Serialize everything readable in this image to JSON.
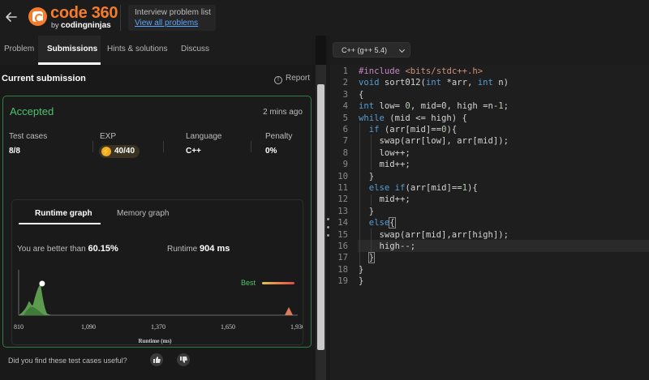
{
  "header": {
    "logo_name": "code 360",
    "logo_by": "by",
    "logo_brand": "codingninjas",
    "list_title": "Interview problem list",
    "list_link": "View all problems"
  },
  "tabs": [
    "Problem",
    "Submissions",
    "Hints & solutions",
    "Discuss"
  ],
  "submission": {
    "section_title": "Current submission",
    "report_label": "Report",
    "status": "Accepted",
    "time_ago": "2 mins ago",
    "stats": [
      {
        "label": "Test cases",
        "value": "8/8"
      },
      {
        "label": "EXP",
        "value": "40/40"
      },
      {
        "label": "Language",
        "value": "C++"
      },
      {
        "label": "Penalty",
        "value": "0%"
      }
    ],
    "graph_tabs": [
      "Runtime graph",
      "Memory graph"
    ],
    "better_prefix": "You are better than",
    "better_value": "60.15%",
    "runtime_prefix": "Runtime",
    "runtime_value": "904 ms",
    "best_label": "Best",
    "feedback_question": "Did you find these test cases useful?"
  },
  "chart_data": {
    "type": "area",
    "xlabel": "Runtime (ms)",
    "x_ticks": [
      "810",
      "1,090",
      "1,370",
      "1,650",
      "1,930"
    ],
    "xlim": [
      810,
      1930
    ],
    "marker_x": 904,
    "legend": "Best"
  },
  "editor": {
    "language": "C++ (g++ 5.4)",
    "lines": [
      "#include <bits/stdc++.h>",
      "void sort012(int *arr, int n)",
      "{",
      "int low= 0, mid=0, high =n-1;",
      "while (mid <= high) {",
      "  if (arr[mid]==0){",
      "    swap(arr[low], arr[mid]);",
      "    low++;",
      "    mid++;",
      "  }",
      "  else if(arr[mid]==1){",
      "    mid++;",
      "  }",
      "  else{",
      "    swap(arr[mid],arr[high]);",
      "    high--;",
      "  }",
      "}",
      "}"
    ]
  },
  "colors": {
    "accent": "#f47c2c",
    "accepted": "#4cc26f",
    "link": "#5aa7ff"
  },
  "icons": [
    "back-arrow-icon",
    "code360-logo-icon",
    "info-circle-icon",
    "lightning-icon",
    "thumbs-up-icon",
    "thumbs-down-icon",
    "chevron-down-icon"
  ]
}
